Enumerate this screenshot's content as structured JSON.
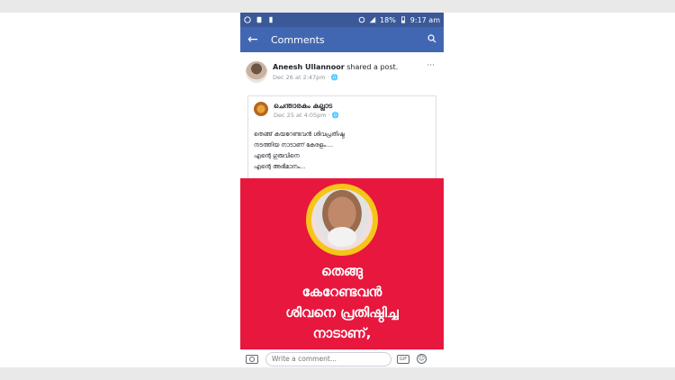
{
  "status_bar": {
    "battery_percent": "18%",
    "time": "9:17 am",
    "icons": [
      "whatsapp-icon",
      "notification-icon",
      "sim-icon",
      "alarm-icon",
      "signal-icon",
      "battery-icon"
    ]
  },
  "app_bar": {
    "title": "Comments",
    "back_icon": "back-arrow-icon",
    "search_icon": "search-icon"
  },
  "post": {
    "sharer": "Aneesh Ullannoor",
    "action": "shared a post.",
    "meta": "Dec 26 at 2:47pm · 🌐",
    "more": "···"
  },
  "shared": {
    "page_name": "ചെന്താരകം കല്ലാട",
    "meta": "Dec 25 at 4:05pm · 🌐",
    "lines": [
      "തെങ്ങ് കയറേണ്ടവൻ ശിവപ്രതിഷ്ഠ",
      "നടത്തിയ നാടാണ് കേരളം....",
      "എന്റെ ഗുരുവിനെ",
      "എന്റെ അഭിമാനം..."
    ]
  },
  "image": {
    "lines": [
      "തെങ്ങു",
      "കേറേണ്ടവൻ",
      "ശിവനെ പ്രതിഷ്ഠിച്ച",
      "നാടാണ്,"
    ],
    "background": "#e8173e",
    "ring_color": "#f5c518"
  },
  "comment_bar": {
    "placeholder": "Write a comment...",
    "gif_label": "GIF"
  }
}
